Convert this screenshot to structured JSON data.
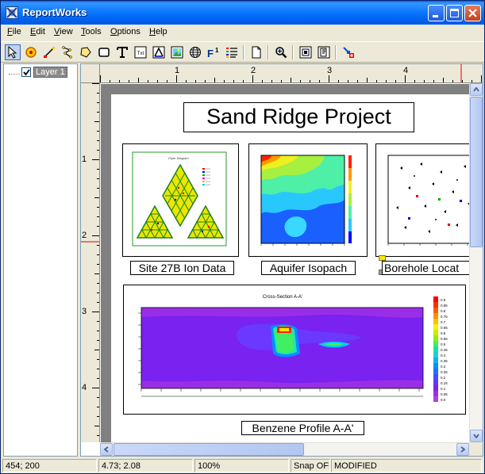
{
  "window": {
    "title": "ReportWorks"
  },
  "menu": [
    {
      "label": "File",
      "key": "F",
      "rest": "ile"
    },
    {
      "label": "Edit",
      "key": "E",
      "rest": "dit"
    },
    {
      "label": "View",
      "key": "V",
      "rest": "iew"
    },
    {
      "label": "Tools",
      "key": "T",
      "rest": "ools"
    },
    {
      "label": "Options",
      "key": "O",
      "rest": "ptions"
    },
    {
      "label": "Help",
      "key": "H",
      "rest": "elp"
    }
  ],
  "toolbar": {
    "tools": [
      "select-arrow-icon",
      "circle-icon",
      "line-icon",
      "polyline-icon",
      "polygon-icon",
      "rectangle-icon",
      "text-icon",
      "text-box-icon",
      "axis-icon",
      "image-icon",
      "globe-icon",
      "superscript-icon",
      "legend-icon",
      "new-page-icon",
      "zoom-icon",
      "page-setup-icon",
      "page-export-icon",
      "layer-remove-icon"
    ],
    "superscript_glyph": "F",
    "superscript_number": "1",
    "text_box_glyph": "Txt"
  },
  "layers": {
    "items": [
      {
        "label": "Layer 1",
        "checked": true
      }
    ]
  },
  "rulers": {
    "horizontal": [
      "1",
      "2",
      "3",
      "4"
    ],
    "vertical": [
      "1",
      "2",
      "3",
      "4"
    ]
  },
  "document": {
    "title": "Sand Ridge Project",
    "panels": [
      {
        "caption": "Site 27B Ion Data",
        "plot_title": "Piper Diagram"
      },
      {
        "caption": "Aquifer Isopach"
      },
      {
        "caption": "Borehole Locat"
      },
      {
        "caption": "Benzene Profile A-A'",
        "plot_title": "Cross-Section A-A'"
      }
    ],
    "colorbar_labels": [
      "0.9",
      "0.85",
      "0.8",
      "0.75",
      "0.7",
      "0.65",
      "0.6",
      "0.55",
      "0.5",
      "0.45",
      "0.4",
      "0.35",
      "0.3",
      "0.25",
      "0.2",
      "0.15",
      "0.1",
      "0.05",
      "0.0"
    ]
  },
  "status": {
    "mouse": "454; 200",
    "coords": "4.73; 2.08",
    "zoom": "100%",
    "snap": "Snap OFF",
    "state": "MODIFIED"
  },
  "colors": {
    "titlebar": "#0058ee",
    "accent_red": "#e00000",
    "selection": "#316ac5"
  }
}
